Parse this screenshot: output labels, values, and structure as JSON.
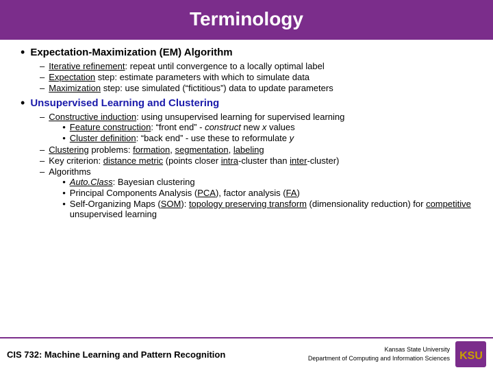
{
  "header": {
    "title": "Terminology"
  },
  "footer": {
    "left": "CIS 732: Machine Learning and Pattern Recognition",
    "right_line1": "Kansas State University",
    "right_line2": "Department of Computing and Information Sciences"
  },
  "sections": [
    {
      "id": "em",
      "bullet": "Expectation-Maximization (EM) Algorithm",
      "blue": false,
      "items": [
        {
          "text_parts": [
            {
              "u": "Iterative refinement"
            },
            {
              "plain": ": repeat until convergence to a locally optimal label"
            }
          ]
        },
        {
          "text_parts": [
            {
              "u": "Expectation"
            },
            {
              "plain": " step: estimate parameters with which to simulate data"
            }
          ]
        },
        {
          "text_parts": [
            {
              "u": "Maximization"
            },
            {
              "plain": " step: use simulated (“fictitious”) data to update parameters"
            }
          ]
        }
      ]
    },
    {
      "id": "unsupervised",
      "bullet": "Unsupervised Learning and Clustering",
      "blue": true,
      "items": [
        {
          "text_parts": [
            {
              "u": "Constructive induction"
            },
            {
              "plain": ": using unsupervised learning for supervised learning"
            }
          ],
          "subitems": [
            {
              "text_parts": [
                {
                  "u": "Feature construction"
                },
                {
                  "plain": ": “front end” - "
                },
                {
                  "italic": "construct"
                },
                {
                  "plain": " new "
                },
                {
                  "italic": "x"
                },
                {
                  "plain": " values"
                }
              ]
            },
            {
              "text_parts": [
                {
                  "u": "Cluster definition"
                },
                {
                  "plain": ": “back end” - use these to reformulate "
                },
                {
                  "italic": "y"
                }
              ]
            }
          ]
        },
        {
          "text_parts": [
            {
              "u": "Clustering"
            },
            {
              "plain": " problems: "
            },
            {
              "u": "formation"
            },
            {
              "plain": ", "
            },
            {
              "u": "segmentation"
            },
            {
              "plain": ", "
            },
            {
              "u": "labeling"
            }
          ]
        },
        {
          "text_parts": [
            {
              "plain": "Key criterion: "
            },
            {
              "u": "distance metric"
            },
            {
              "plain": " (points closer "
            },
            {
              "u": "intra"
            },
            {
              "plain": "-cluster than "
            },
            {
              "u": "inter"
            },
            {
              "plain": "-cluster)"
            }
          ]
        },
        {
          "text_parts": [
            {
              "plain": "Algorithms"
            }
          ],
          "subitems": [
            {
              "text_parts": [
                {
                  "italic_u": "Auto.Class"
                },
                {
                  "plain": ": Bayesian clustering"
                }
              ]
            },
            {
              "text_parts": [
                {
                  "plain": "Principal Components Analysis ("
                },
                {
                  "u": "PCA"
                },
                {
                  "plain": "), factor analysis ("
                },
                {
                  "u": "FA"
                },
                {
                  "plain": ")"
                }
              ]
            },
            {
              "text_parts": [
                {
                  "plain": "Self-Organizing Maps ("
                },
                {
                  "u": "SOM"
                },
                {
                  "plain": "): "
                },
                {
                  "u": "topology preserving transform"
                },
                {
                  "plain": " (dimensionality reduction) for "
                },
                {
                  "u": "competitive"
                },
                {
                  "plain": " unsupervised learning"
                }
              ]
            }
          ]
        }
      ]
    }
  ]
}
